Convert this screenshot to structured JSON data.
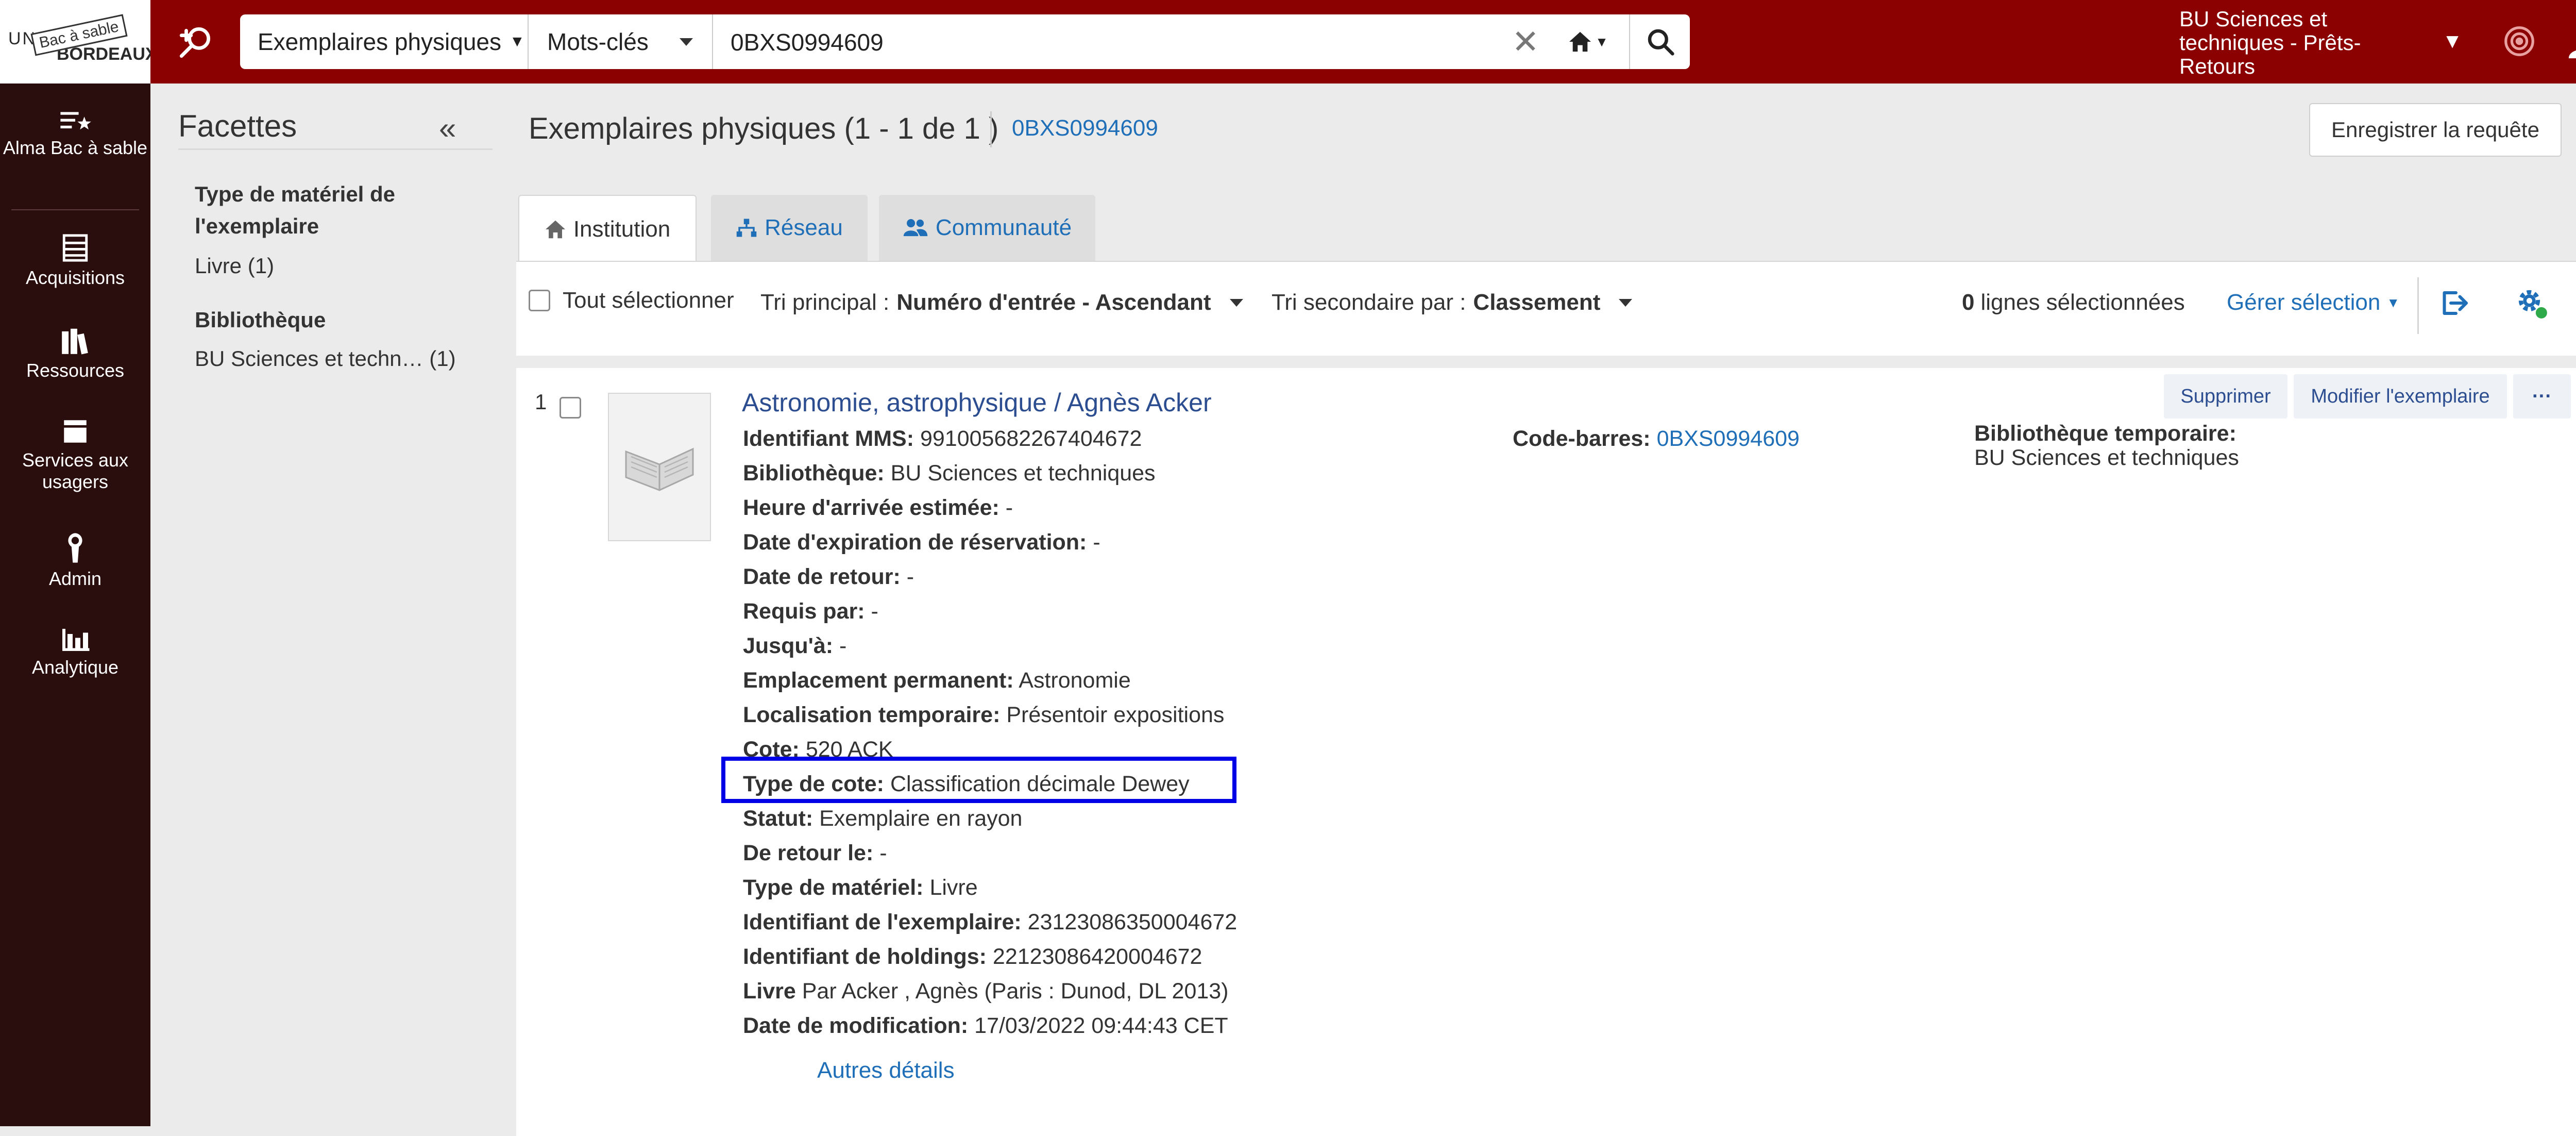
{
  "header": {
    "logo_text_top": "UNIV",
    "logo_text_bottom": "BORDEAUX",
    "logo_stamp": "Bac à sable",
    "search_scope": "Exemplaires physiques",
    "search_field": "Mots-clés",
    "search_value": "0BXS0994609",
    "institution": "BU Sciences et techniques - Prêts-Retours",
    "colors": {
      "brand": "#8b0000",
      "nav": "#2a0d0d",
      "link": "#1f6fb8",
      "highlight": "#0000e6"
    }
  },
  "nav": [
    {
      "label": "Alma Bac à sable",
      "icon": "list-star-icon"
    },
    {
      "label": "Acquisitions",
      "icon": "abacus-icon"
    },
    {
      "label": "Ressources",
      "icon": "books-icon"
    },
    {
      "label": "Services aux usagers",
      "icon": "inbox-icon"
    },
    {
      "label": "Admin",
      "icon": "wrench-icon"
    },
    {
      "label": "Analytique",
      "icon": "bar-chart-icon"
    }
  ],
  "facets": {
    "title": "Facettes",
    "groups": [
      {
        "head": "Type de matériel de l'exemplaire",
        "value": "Livre",
        "count": "(1)"
      },
      {
        "head": "Bibliothèque",
        "value": "BU Sciences et techn…",
        "count": "(1)"
      }
    ]
  },
  "results": {
    "title": "Exemplaires physiques (1 - 1 de 1 )",
    "query_link": "0BXS0994609",
    "save_label": "Enregistrer la requête",
    "tabs": [
      "Institution",
      "Réseau",
      "Communauté"
    ],
    "select_all": "Tout sélectionner",
    "sort_primary_label": "Tri principal :",
    "sort_primary_value": "Numéro d'entrée - Ascendant",
    "sort_secondary_label": "Tri secondaire par :",
    "sort_secondary_value": "Classement",
    "selected_count": "0",
    "selected_label": "lignes sélectionnées",
    "manage_selection": "Gérer sélection"
  },
  "record": {
    "index": "1",
    "title": "Astronomie, astrophysique / Agnès Acker",
    "actions": [
      "Supprimer",
      "Modifier l'exemplaire",
      "···"
    ],
    "fields": [
      {
        "k": "Identifiant MMS:",
        "v": "991005682267404672"
      },
      {
        "k": "Bibliothèque:",
        "v": "BU Sciences et techniques"
      },
      {
        "k": "Heure d'arrivée estimée:",
        "v": "-"
      },
      {
        "k": "Date d'expiration de réservation:",
        "v": "-"
      },
      {
        "k": "Date de retour:",
        "v": "-"
      },
      {
        "k": "Requis par:",
        "v": "-"
      },
      {
        "k": "Jusqu'à:",
        "v": "-"
      },
      {
        "k": "Emplacement permanent:",
        "v": "Astronomie"
      },
      {
        "k": "Localisation temporaire:",
        "v": "Présentoir expositions"
      },
      {
        "k": "Cote:",
        "v": "520 ACK"
      },
      {
        "k": "Type de cote:",
        "v": "Classification décimale Dewey"
      },
      {
        "k": "Statut:",
        "v": "Exemplaire en rayon"
      },
      {
        "k": "De retour le:",
        "v": "-"
      },
      {
        "k": "Type de matériel:",
        "v": "Livre"
      },
      {
        "k": "Identifiant de l'exemplaire:",
        "v": "23123086350004672"
      },
      {
        "k": "Identifiant de holdings:",
        "v": "22123086420004672"
      },
      {
        "k": "Livre",
        "v": "Par Acker , Agnès (Paris : Dunod, DL 2013)"
      },
      {
        "k": "Date de modification:",
        "v": "17/03/2022 09:44:43 CET"
      }
    ],
    "barcode_label": "Code-barres:",
    "barcode_value": "0BXS0994609",
    "temp_library_label": "Bibliothèque temporaire:",
    "temp_library_value": "BU Sciences et techniques",
    "more_details": "Autres détails"
  }
}
